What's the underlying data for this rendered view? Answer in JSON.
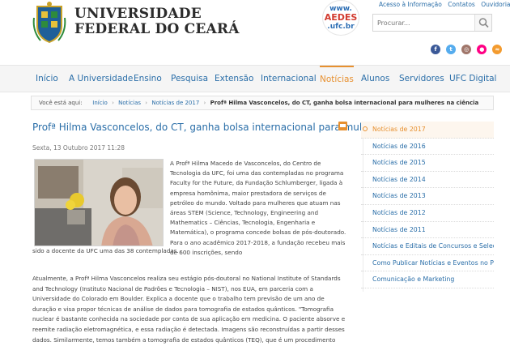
{
  "header": {
    "brand_line1": "Universidade",
    "brand_line2": "Federal do Ceará",
    "aedes": {
      "l1": "www.",
      "l2": "AEDES",
      "l3": ".ufc.br"
    },
    "toplinks": [
      "Acesso à Informação",
      "Contatos",
      "Ouvidoria"
    ],
    "search_placeholder": "Procurar...",
    "social_icons": [
      "facebook-icon",
      "twitter-icon",
      "instagram-icon",
      "flickr-icon",
      "rss-icon"
    ],
    "colors": {
      "accent": "#e7902f",
      "link": "#2a6ea8"
    }
  },
  "nav": {
    "items": [
      "Início",
      "A Universidade",
      "Ensino",
      "Pesquisa",
      "Extensão",
      "Internacional",
      "Notícias",
      "Alunos",
      "Servidores",
      "UFC Digital"
    ],
    "active": "Notícias"
  },
  "breadcrumb": {
    "prefix": "Você está aqui:",
    "items": [
      "Início",
      "Notícias",
      "Notícias de 2017"
    ],
    "current": "Profª Hilma Vasconcelos, do CT, ganha bolsa internacional para mulheres na ciência"
  },
  "article": {
    "title": "Profª Hilma Vasconcelos, do CT, ganha bolsa internacional para mulheres na ciência",
    "date": "Sexta, 13 Outubro 2017 11:28",
    "intro": "A Profª Hilma Macedo de Vasconcelos, do Centro de Tecnologia da UFC, foi uma das contempladas no programa Faculty for the Future, da Fundação Schlumberger, ligada à empresa homônima, maior prestadora de serviços de petróleo do mundo. Voltado para mulheres que atuam nas áreas STEM (Science, Technology, Engineering and Mathematics – Ciências, Tecnologia, Engenharia e Matemática), o programa concede bolsas de pós-doutorado. Para o ano acadêmico 2017-2018, a fundação recebeu mais de 600 inscrições, sendo",
    "intro_cont": "sido a docente da UFC uma das 38 contempladas.",
    "para2": "Atualmente, a Profª Hilma Vasconcelos realiza seu estágio pós-doutoral no National Institute of Standards and Technology (Instituto Nacional de Padrões e Tecnologia – NIST), nos EUA, em parceria com a Universidade do Colorado em Boulder. Explica a docente que o trabalho tem previsão de um ano de duração e visa propor técnicas de análise de dados para tomografia de estados quânticos. \"Tomografia nuclear é bastante conhecida na sociedade por conta de sua aplicação em medicina. O paciente absorve e reemite radiação eletromagnética, e essa radiação é detectada. Imagens são reconstruídas a partir desses dados. Similarmente, temos também a tomografia de estados quânticos (TEQ), que é um procedimento experimental para caracterizar um estado"
  },
  "sidebar": {
    "items": [
      "Notícias de 2017",
      "Notícias de 2016",
      "Notícias de 2015",
      "Notícias de 2014",
      "Notícias de 2013",
      "Notícias de 2012",
      "Notícias de 2011",
      "Notícias e Editais de Concursos e Seleções",
      "Como Publicar Notícias e Eventos no Portal",
      "Comunicação e Marketing"
    ],
    "active_index": 0
  }
}
